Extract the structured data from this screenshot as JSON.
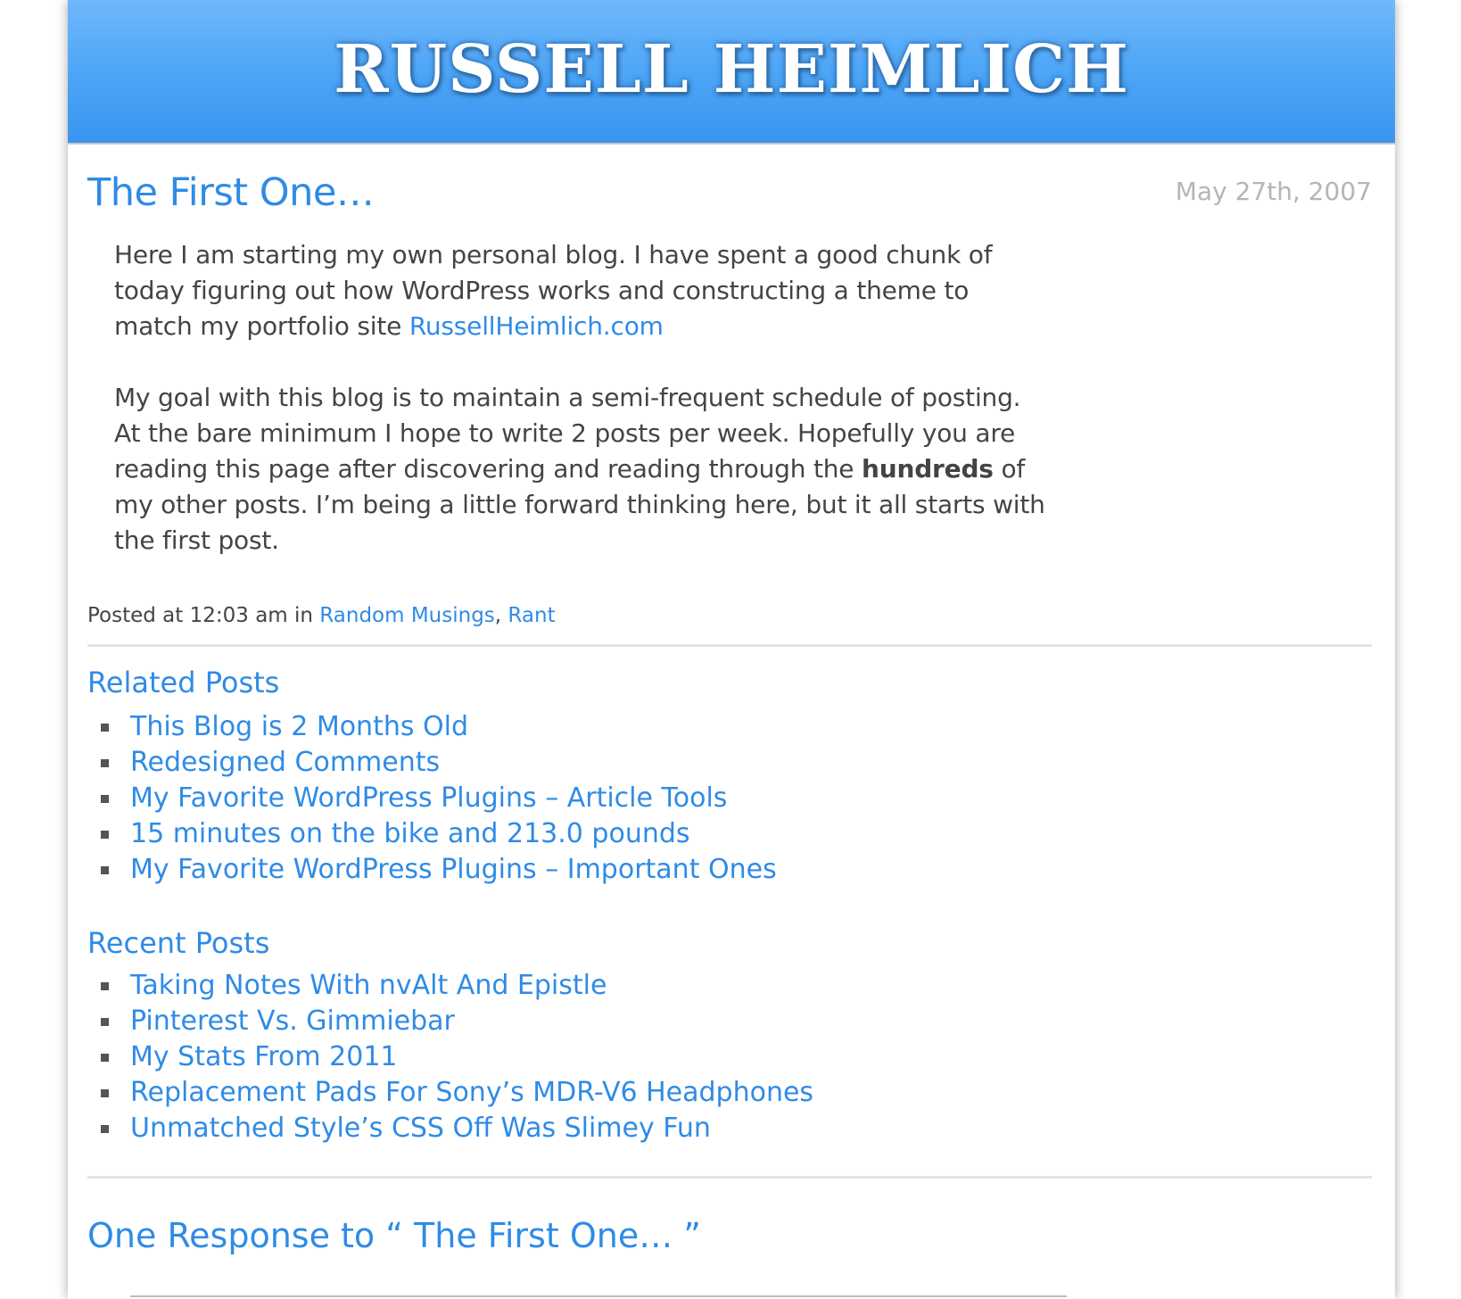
{
  "site": {
    "title": "RUSSELL HEIMLICH"
  },
  "post": {
    "title": "The First One…",
    "date": "May 27th, 2007",
    "para1_text": "Here I am starting my own personal blog. I have spent a good chunk of today figuring out how WordPress works and constructing a theme to match my portfolio site ",
    "para1_link": "RussellHeimlich.com",
    "para2_before": "My goal with this blog is to maintain a semi-frequent schedule of posting. At the bare minimum I hope to write 2 posts per week. Hopefully you are reading this page after discovering and reading through the ",
    "para2_bold": "hundreds",
    "para2_after": " of my other posts. I’m being a little forward thinking here, but it all starts with the first post.",
    "meta_prefix": "Posted at 12:03 am in ",
    "categories": [
      "Random Musings",
      "Rant"
    ],
    "category_separator": ", "
  },
  "related_posts": {
    "heading": "Related Posts",
    "items": [
      "This Blog is 2 Months Old",
      "Redesigned Comments",
      "My Favorite WordPress Plugins – Article Tools",
      "15 minutes on the bike and 213.0 pounds",
      "My Favorite WordPress Plugins – Important Ones"
    ]
  },
  "recent_posts": {
    "heading": "Recent Posts",
    "items": [
      "Taking Notes With nvAlt And Epistle",
      "Pinterest Vs. Gimmiebar",
      "My Stats From 2011",
      "Replacement Pads For Sony’s MDR-V6 Headphones",
      "Unmatched Style’s CSS Off Was Slimey Fun"
    ]
  },
  "comments": {
    "heading": "One Response to “ The First One… ”"
  },
  "colors": {
    "link": "#2f8be6",
    "header_top": "#6fb8fb",
    "header_bottom": "#3a95f0",
    "date": "#b5b5b5",
    "body_text": "#444444"
  }
}
